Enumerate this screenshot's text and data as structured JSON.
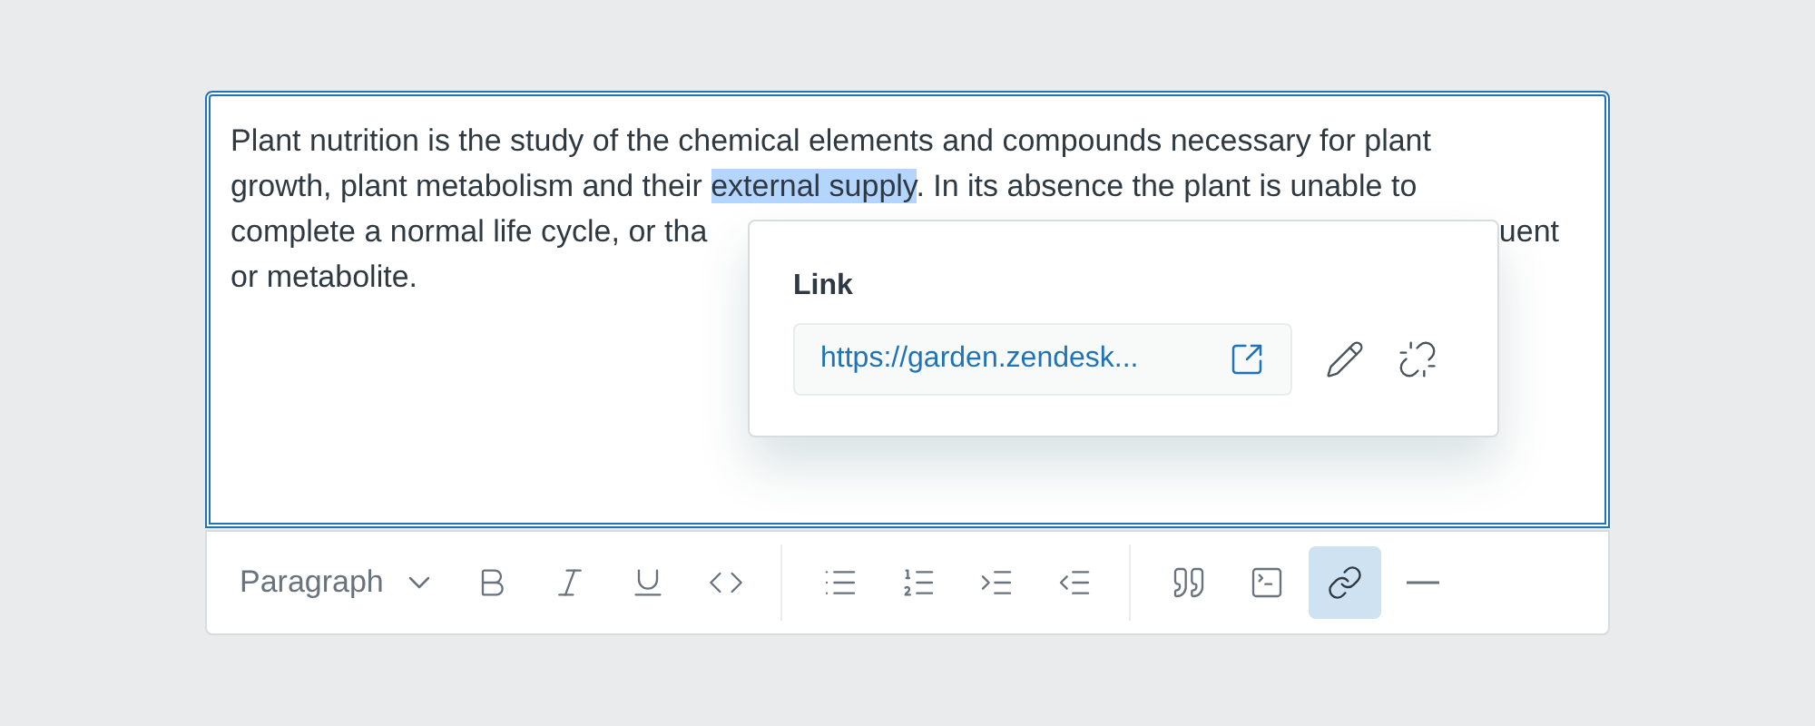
{
  "editor": {
    "lines": [
      {
        "segments": [
          {
            "text": "Plant nutrition is the study of the chemical elements and compounds necessary for plant",
            "highlighted": false
          }
        ]
      },
      {
        "segments": [
          {
            "text": "growth, plant metabolism and their ",
            "highlighted": false
          },
          {
            "text": "external supply",
            "highlighted": true
          },
          {
            "text": ". In its absence the plant is unable to",
            "highlighted": false
          }
        ]
      },
      {
        "left": "complete a normal life cycle, or tha",
        "right": "uent"
      },
      {
        "segments": [
          {
            "text": "or metabolite.",
            "highlighted": false
          }
        ]
      }
    ]
  },
  "link_popover": {
    "title": "Link",
    "url": "https://garden.zendesk..."
  },
  "toolbar": {
    "block_format": "Paragraph",
    "groups": [
      [
        {
          "kind": "bold",
          "selected": false
        },
        {
          "kind": "italic",
          "selected": false
        },
        {
          "kind": "underline",
          "selected": false
        },
        {
          "kind": "code",
          "selected": false
        }
      ],
      [
        {
          "kind": "bulleted-list",
          "selected": false
        },
        {
          "kind": "numbered-list",
          "selected": false
        },
        {
          "kind": "indent",
          "selected": false
        },
        {
          "kind": "outdent",
          "selected": false
        }
      ],
      [
        {
          "kind": "quote",
          "selected": false
        },
        {
          "kind": "code-block",
          "selected": false
        },
        {
          "kind": "link",
          "selected": true
        },
        {
          "kind": "horizontal-rule",
          "selected": false
        }
      ]
    ]
  }
}
